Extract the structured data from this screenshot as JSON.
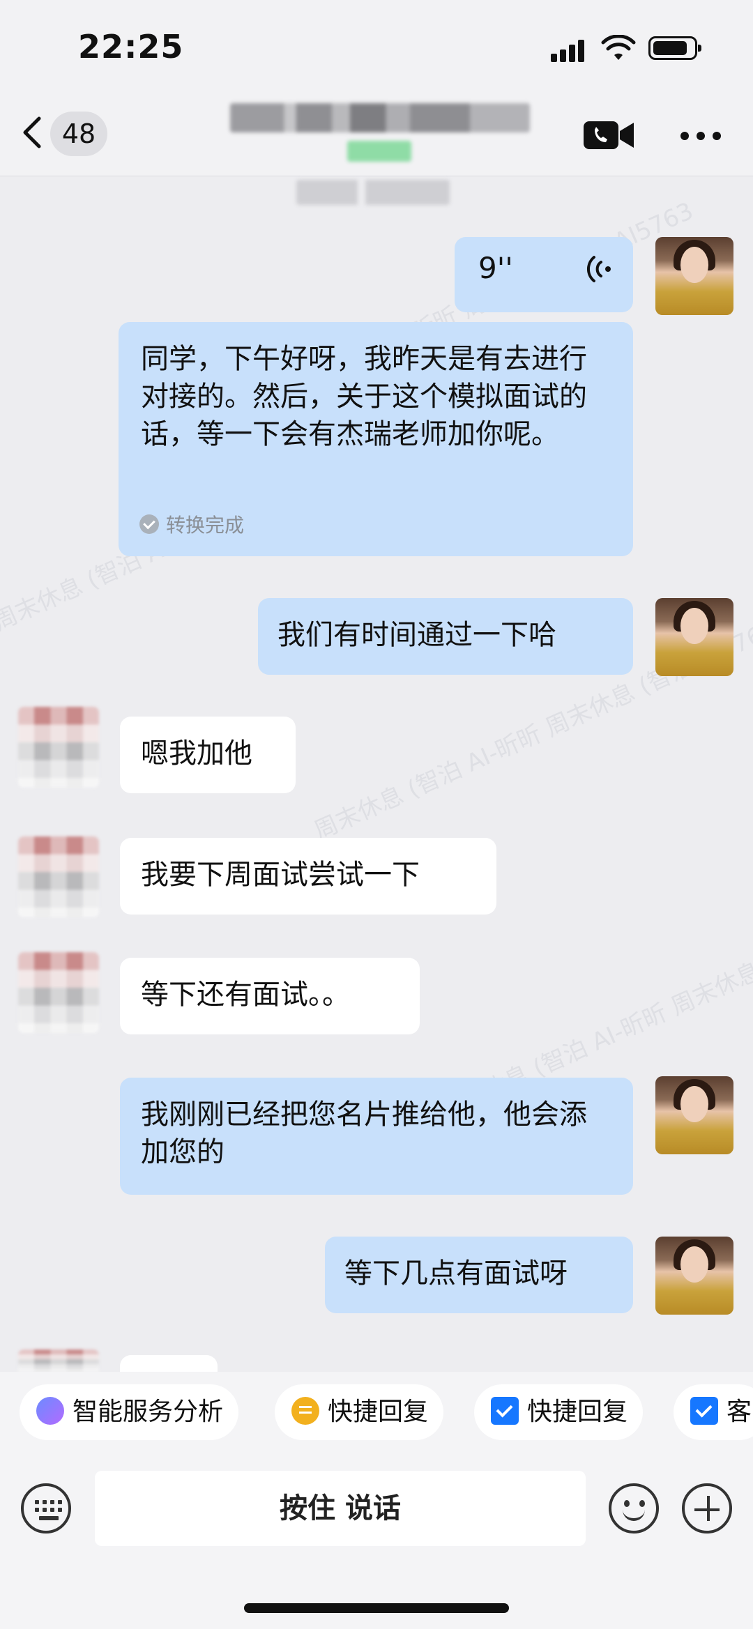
{
  "status_bar": {
    "time": "22:25"
  },
  "nav": {
    "unread_count": "48"
  },
  "messages": [
    {
      "side": "out",
      "type": "voice",
      "duration": "9''"
    },
    {
      "side": "out",
      "type": "voice_text",
      "text": "同学，下午好呀，我昨天是有去进行对接的。然后，关于这个模拟面试的话，等一下会有杰瑞老师加你呢。",
      "status": "转换完成"
    },
    {
      "side": "out",
      "text": "我们有时间通过一下哈"
    },
    {
      "side": "in",
      "text": "嗯我加他"
    },
    {
      "side": "in",
      "text": "我要下周面试尝试一下"
    },
    {
      "side": "in",
      "text": "等下还有面试。。"
    },
    {
      "side": "out",
      "text": "我刚刚已经把您名片推给他，他会添加您的"
    },
    {
      "side": "out",
      "text": "等下几点有面试呀"
    }
  ],
  "watermark": "周末休息 (智泊 AI-昕昕 周末休息 (智泊 AI5763",
  "quick_actions": [
    {
      "label": "智能服务分析",
      "icon": "ai-sparkle-icon"
    },
    {
      "label": "快捷回复",
      "icon": "quick-reply-icon"
    },
    {
      "label": "快捷回复",
      "icon": "checkbox-icon"
    },
    {
      "label": "客",
      "icon": "checkbox-icon"
    }
  ],
  "input_bar": {
    "hold_to_talk": "按住 说话"
  }
}
